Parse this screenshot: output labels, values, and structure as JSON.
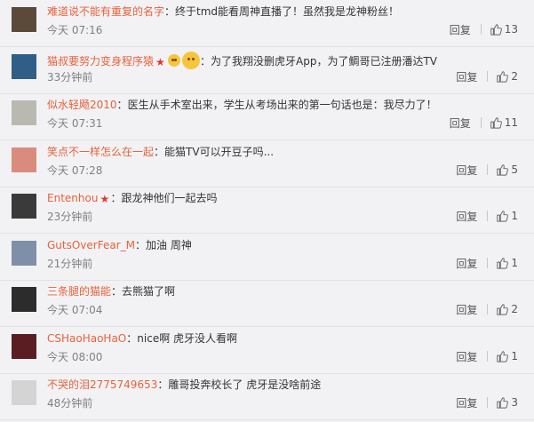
{
  "comments": [
    {
      "user": "难道说不能有重复的名字",
      "text": "终于tmd能看周神直播了！虽然我是龙神粉丝！",
      "time": "今天 07:16",
      "likes": "13",
      "has_badge": false,
      "avatar_color": "#5b4a3a",
      "emoticons": []
    },
    {
      "user": "猫叔要努力变身程序猿",
      "text": "为了我翔没删虎牙App，为了鲷哥已注册潘达TV",
      "time": "33分钟前",
      "likes": "2",
      "has_badge": true,
      "avatar_color": "#2f5f86",
      "emoticons": [
        "face-emoticon-small",
        "face-emoticon-big"
      ]
    },
    {
      "user": "似水轻飏2010",
      "text": "医生从手术室出来，学生从考场出来的第一句话也是：我尽力了！",
      "time": "今天 07:31",
      "likes": "11",
      "has_badge": false,
      "avatar_color": "#b9b9b0",
      "emoticons": []
    },
    {
      "user": "笑点不一样怎么在一起",
      "text": "能猫TV可以开豆子吗...",
      "time": "今天 07:28",
      "likes": "5",
      "has_badge": false,
      "avatar_color": "#d98c7e",
      "emoticons": []
    },
    {
      "user": "Entenhou",
      "text": "跟龙神他们一起去吗",
      "time": "23分钟前",
      "likes": "1",
      "has_badge": true,
      "avatar_color": "#3a3a3a",
      "emoticons": []
    },
    {
      "user": "GutsOverFear_M",
      "text": "加油 周神",
      "time": "21分钟前",
      "likes": "1",
      "has_badge": false,
      "avatar_color": "#7f8fa8",
      "emoticons": []
    },
    {
      "user": "三条腿的猫能",
      "text": "去熊猫了啊",
      "time": "今天 07:04",
      "likes": "2",
      "has_badge": false,
      "avatar_color": "#2c2c2c",
      "emoticons": []
    },
    {
      "user": "CSHaoHaoHaO",
      "text": "nice啊 虎牙没人看啊",
      "time": "今天 08:00",
      "likes": "1",
      "has_badge": false,
      "avatar_color": "#5a1e22",
      "emoticons": []
    },
    {
      "user": "不哭的泪2775749653",
      "text": "雕哥投奔校长了 虎牙是没啥前途",
      "time": "48分钟前",
      "likes": "3",
      "has_badge": false,
      "avatar_color": "#d4d4d4",
      "emoticons": []
    }
  ],
  "labels": {
    "reply": "回复",
    "colon": "："
  },
  "icons": {
    "avatar": "user-avatar",
    "verified": "verified-star-icon",
    "like": "thumbs-up-icon"
  },
  "colors": {
    "username": "#e8623a",
    "badge": "#e8342a",
    "background": "#f2f2f5"
  }
}
